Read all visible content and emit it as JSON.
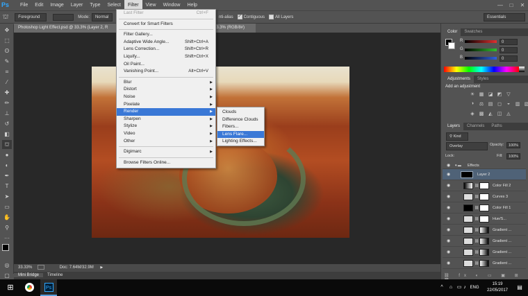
{
  "app": {
    "logo": "Ps"
  },
  "menubar": {
    "items": [
      "File",
      "Edit",
      "Image",
      "Layer",
      "Type",
      "Select",
      "Filter",
      "View",
      "Window",
      "Help"
    ],
    "active": "Filter",
    "window_controls": [
      "—",
      "□",
      "✕"
    ]
  },
  "options": {
    "foreground_select": "Foreground",
    "mode_label": "Mode:",
    "mode_value": "Normal",
    "antialias_label": "nti-alias",
    "contiguous_label": "Contiguous",
    "all_layers_label": "All Layers",
    "workspace": "Essentials"
  },
  "document": {
    "tab_title": "Photoshop Light Effect.psd @ 33.3% (Layer 2, R",
    "tab_suffix": "33.3% (RGB/8#)",
    "zoom": "33.33%",
    "doc_size": "Doc: 7.64M/32.9M"
  },
  "bottom_tabs": [
    "Mini Bridge",
    "Timeline"
  ],
  "filter_menu": {
    "groups": [
      [
        {
          "label": "Last Filter",
          "shortcut": "Ctrl+F",
          "disabled": true
        }
      ],
      [
        {
          "label": "Convert for Smart Filters"
        }
      ],
      [
        {
          "label": "Filter Gallery..."
        },
        {
          "label": "Adaptive Wide Angle...",
          "shortcut": "Shift+Ctrl+A"
        },
        {
          "label": "Lens Correction...",
          "shortcut": "Shift+Ctrl+R"
        },
        {
          "label": "Liquify...",
          "shortcut": "Shift+Ctrl+X"
        },
        {
          "label": "Oil Paint..."
        },
        {
          "label": "Vanishing Point...",
          "shortcut": "Alt+Ctrl+V"
        }
      ],
      [
        {
          "label": "Blur",
          "sub": true
        },
        {
          "label": "Distort",
          "sub": true
        },
        {
          "label": "Noise",
          "sub": true
        },
        {
          "label": "Pixelate",
          "sub": true
        },
        {
          "label": "Render",
          "sub": true,
          "highlighted": true
        },
        {
          "label": "Sharpen",
          "sub": true
        },
        {
          "label": "Stylize",
          "sub": true
        },
        {
          "label": "Video",
          "sub": true
        },
        {
          "label": "Other",
          "sub": true
        }
      ],
      [
        {
          "label": "Digimarc",
          "sub": true
        }
      ],
      [
        {
          "label": "Browse Filters Online..."
        }
      ]
    ]
  },
  "render_submenu": {
    "items": [
      "Clouds",
      "Difference Clouds",
      "Fibers...",
      "Lens Flare...",
      "Lighting Effects..."
    ],
    "highlighted": "Lens Flare..."
  },
  "color_panel": {
    "tabs": [
      "Color",
      "Swatches"
    ],
    "channels": [
      {
        "label": "R",
        "value": "0",
        "color": "#e03030"
      },
      {
        "label": "G",
        "value": "0",
        "color": "#30c030"
      },
      {
        "label": "B",
        "value": "0",
        "color": "#3060e0"
      }
    ]
  },
  "adjustments_panel": {
    "tabs": [
      "Adjustments",
      "Styles"
    ],
    "title": "Add an adjustment"
  },
  "layers_panel": {
    "tabs": [
      "Layers",
      "Channels",
      "Paths"
    ],
    "filter_kind": "Kind",
    "blend_mode": "Overlay",
    "opacity_label": "Opacity:",
    "opacity": "100%",
    "lock_label": "Lock:",
    "fill_label": "Fill:",
    "fill": "100%",
    "layers": [
      {
        "name": "Effects",
        "type": "group"
      },
      {
        "name": "Layer 2",
        "type": "pixel",
        "selected": true
      },
      {
        "name": "Color Fill 2",
        "type": "adj"
      },
      {
        "name": "Curves 3",
        "type": "adj"
      },
      {
        "name": "Color Fill 1",
        "type": "adj"
      },
      {
        "name": "Hue/S...",
        "type": "adj"
      },
      {
        "name": "Gradient ...",
        "type": "adj"
      },
      {
        "name": "Gradient ...",
        "type": "adj"
      },
      {
        "name": "Gradient ...",
        "type": "adj"
      },
      {
        "name": "Gradient ...",
        "type": "adj"
      }
    ]
  },
  "taskbar": {
    "time": "15:19",
    "date": "22/05/2017",
    "lang": "ENG"
  }
}
